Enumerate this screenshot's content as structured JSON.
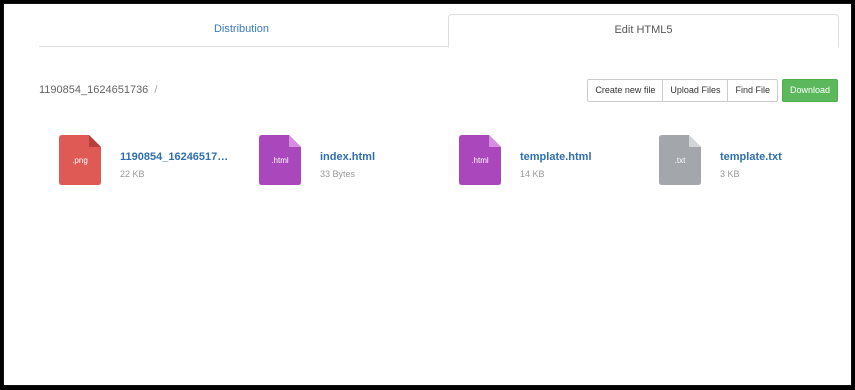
{
  "tabs": [
    {
      "label": "Distribution",
      "active": false
    },
    {
      "label": "Edit HTML5",
      "active": true
    }
  ],
  "breadcrumb": {
    "path": "1190854_1624651736",
    "separator": "/"
  },
  "toolbar": {
    "create_label": "Create new file",
    "upload_label": "Upload Files",
    "find_label": "Find File",
    "download_label": "Download"
  },
  "files": [
    {
      "name": "1190854_16246517…",
      "size": "22 KB",
      "ext": ".png",
      "color": "#e05a55",
      "icon": "png-file-icon"
    },
    {
      "name": "index.html",
      "size": "33 Bytes",
      "ext": ".html",
      "color": "#ab47bc",
      "icon": "html-file-icon"
    },
    {
      "name": "template.html",
      "size": "14 KB",
      "ext": ".html",
      "color": "#ab47bc",
      "icon": "html-file-icon"
    },
    {
      "name": "template.txt",
      "size": "3 KB",
      "ext": ".txt",
      "color": "#a3a6ab",
      "icon": "txt-file-icon"
    }
  ],
  "colors": {
    "link": "#2f6fb0",
    "download": "#5cb85c"
  }
}
